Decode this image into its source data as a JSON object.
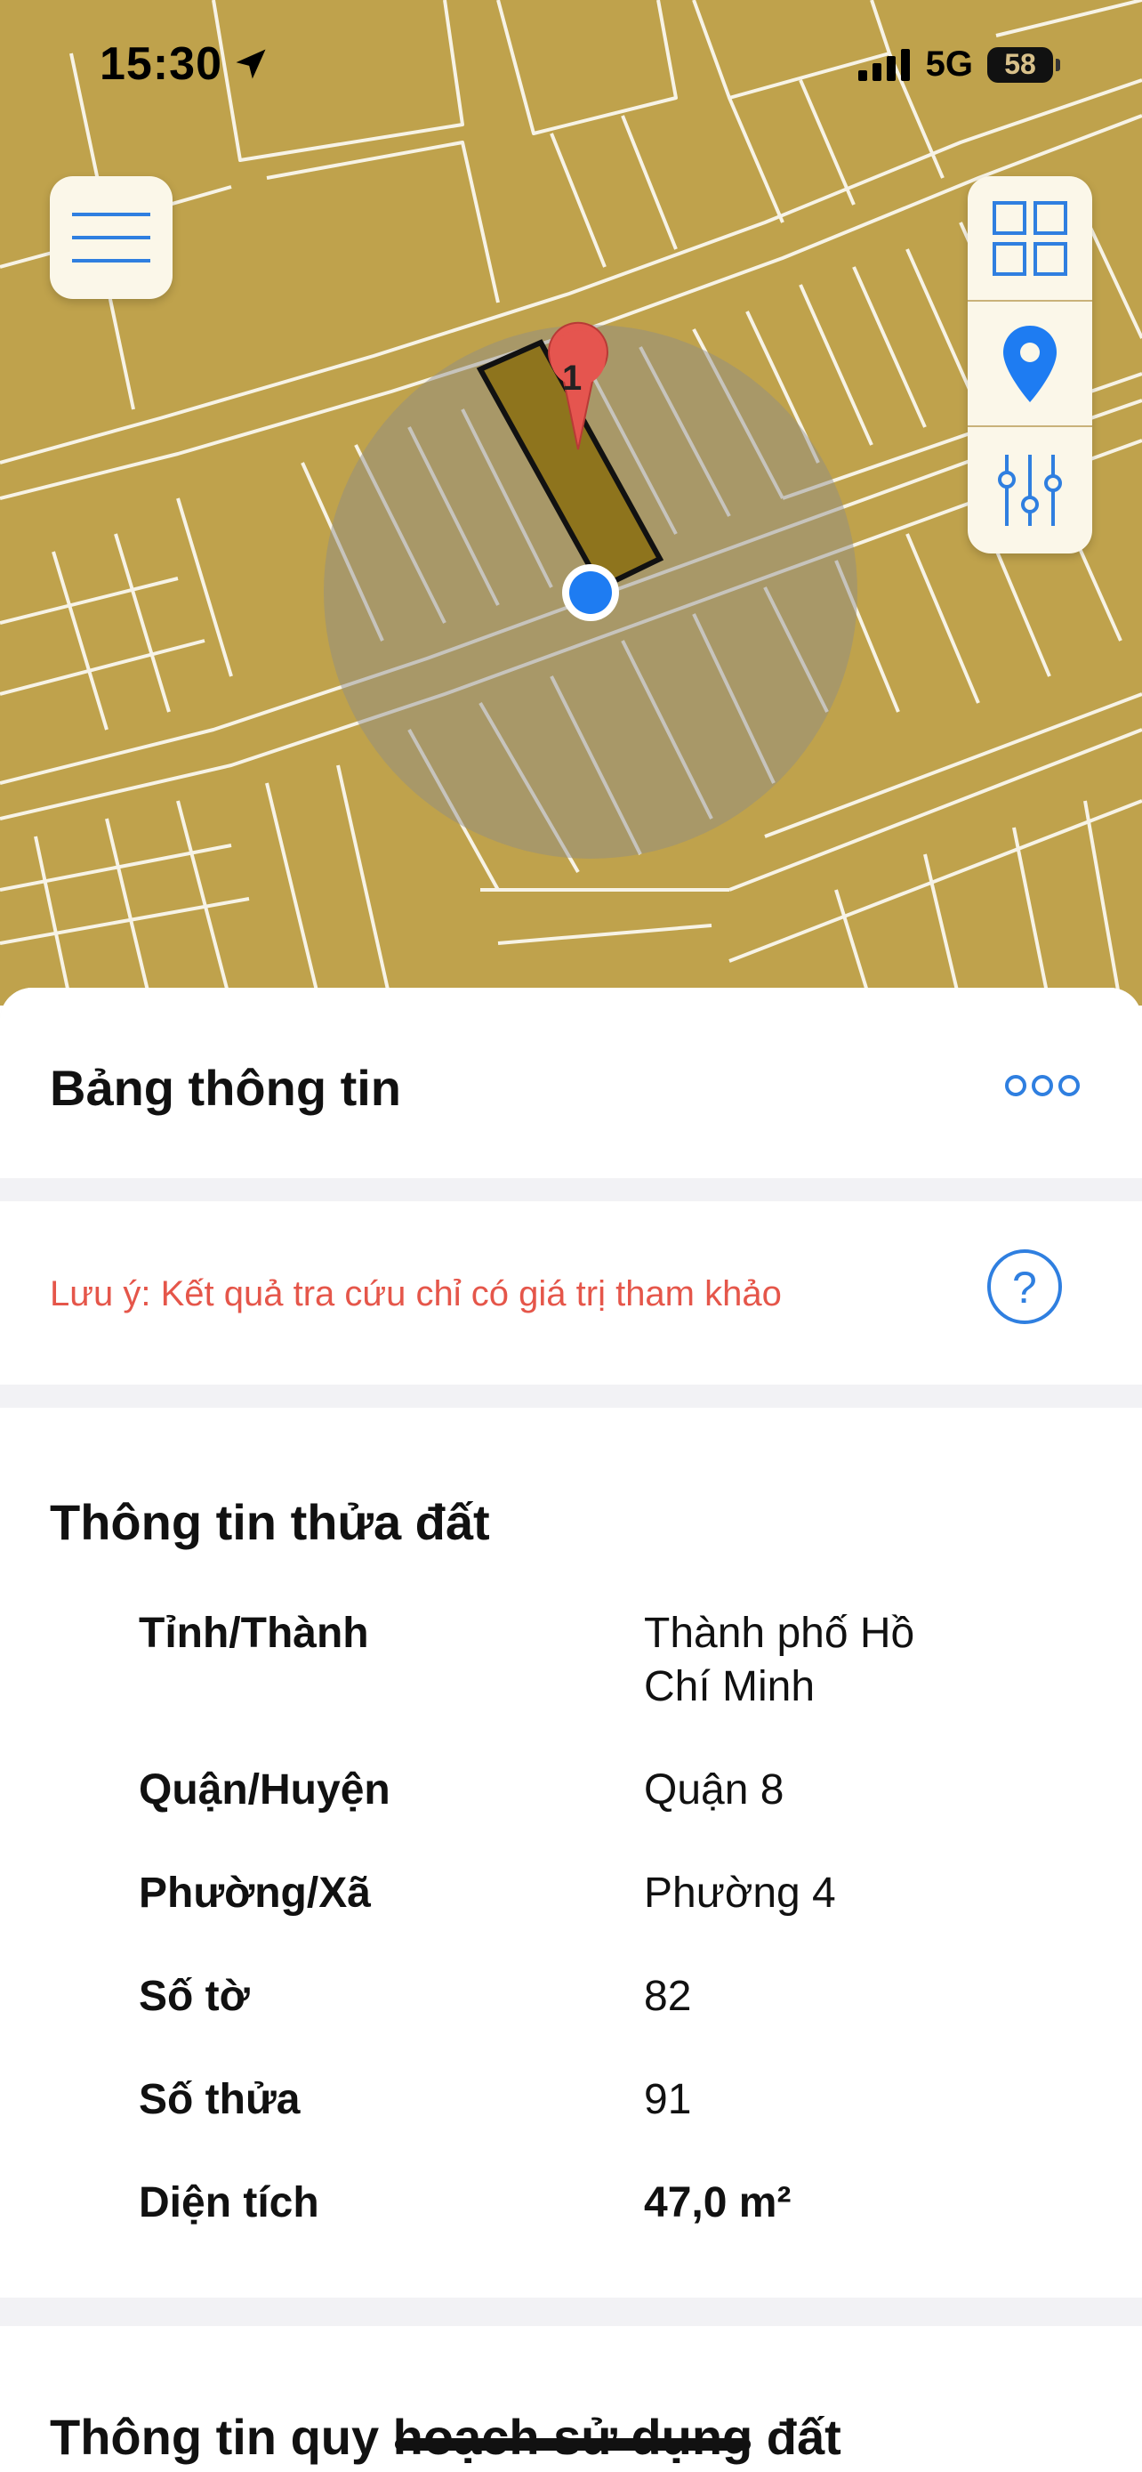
{
  "status_bar": {
    "time": "15:30",
    "network": "5G",
    "battery": "58"
  },
  "map": {
    "marker_label": "1",
    "colors": {
      "land": "#bfa24c",
      "parcel_lines": "#f7f3e6",
      "selected_parcel": "#8e741d",
      "marker": "#e5554f",
      "location_dot": "#1e7cf2"
    },
    "icons": [
      "menu-icon",
      "grid-layers-icon",
      "location-pin-icon",
      "sliders-icon"
    ]
  },
  "sheet": {
    "title": "Bảng thông tin",
    "notice": "Lưu ý: Kết quả tra cứu chỉ có giá trị tham khảo",
    "parcel_section": {
      "title": "Thông tin thửa đất",
      "rows": [
        {
          "label": "Tỉnh/Thành",
          "value": "Thành phố Hồ Chí Minh"
        },
        {
          "label": "Quận/Huyện",
          "value": "Quận 8"
        },
        {
          "label": "Phường/Xã",
          "value": "Phường 4"
        },
        {
          "label": "Số tờ",
          "value": "82"
        },
        {
          "label": "Số thửa",
          "value": "91"
        },
        {
          "label": "Diện tích",
          "value": "47,0 m²"
        }
      ]
    },
    "planning_section": {
      "title": "Thông tin quy hoạch sử dụng đất"
    }
  },
  "accent_color": "#2f7fe0"
}
